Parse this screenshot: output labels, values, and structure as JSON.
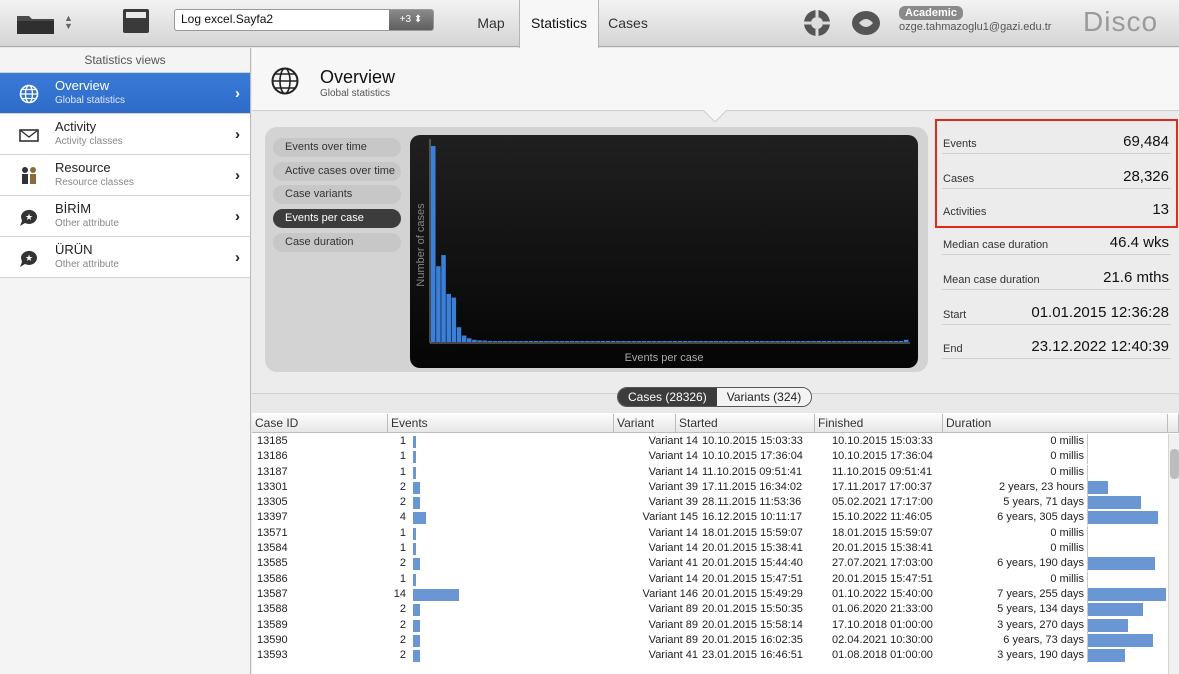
{
  "toolbar": {
    "log_name": "Log excel.Sayfa2",
    "log_badge": "+3 ⬍",
    "tabs": [
      {
        "label": "Map"
      },
      {
        "label": "Statistics"
      },
      {
        "label": "Cases"
      }
    ],
    "license_badge": "Academic",
    "user_email": "ozge.tahmazoglu1@gazi.edu.tr",
    "brand": "Disco",
    "icons": [
      "folder-icon",
      "sort-arrows-icon",
      "document-icon",
      "lifebuoy-icon",
      "bug-icon"
    ]
  },
  "sidebar": {
    "title": "Statistics views",
    "items": [
      {
        "label": "Overview",
        "sub": "Global statistics",
        "icon": "globe-icon",
        "active": true
      },
      {
        "label": "Activity",
        "sub": "Activity classes",
        "icon": "envelope-icon"
      },
      {
        "label": "Resource",
        "sub": "Resource classes",
        "icon": "people-icon"
      },
      {
        "label": "BİRİM",
        "sub": "Other attribute",
        "icon": "tag-bubble-icon"
      },
      {
        "label": "ÜRÜN",
        "sub": "Other attribute",
        "icon": "tag-bubble-icon"
      }
    ]
  },
  "header": {
    "title": "Overview",
    "subtitle": "Global statistics"
  },
  "chart_views": [
    {
      "label": "Events over time"
    },
    {
      "label": "Active cases over time"
    },
    {
      "label": "Case variants"
    },
    {
      "label": "Events per case",
      "active": true
    },
    {
      "label": "Case duration"
    }
  ],
  "chart_data": {
    "type": "bar",
    "xlabel": "Events per case",
    "ylabel": "Number of cases",
    "series": [
      {
        "values": [
          10600,
          4100,
          4700,
          2600,
          2400,
          800,
          350,
          200,
          120,
          90,
          80,
          60,
          50,
          40,
          35,
          30,
          28,
          26,
          24,
          22,
          20,
          20,
          20,
          20,
          20,
          20,
          20,
          20,
          20,
          20,
          20,
          20,
          20,
          20,
          20,
          20,
          20,
          20,
          20,
          20,
          20,
          20,
          20,
          20,
          20,
          20,
          20,
          20,
          20,
          20,
          20,
          20,
          20,
          20,
          20,
          20,
          20,
          20,
          20,
          20,
          20,
          20,
          20,
          20,
          20,
          20,
          20,
          20,
          20,
          20,
          20,
          20,
          20,
          20,
          20,
          20,
          20,
          20,
          20,
          20,
          20,
          20,
          20,
          20,
          20,
          20,
          20,
          20,
          20,
          20,
          20,
          20,
          120
        ]
      }
    ],
    "colors": {
      "bar": "#3a7fd8"
    },
    "grid": false
  },
  "stats": [
    {
      "label": "Events",
      "value": "69,484"
    },
    {
      "label": "Cases",
      "value": "28,326"
    },
    {
      "label": "Activities",
      "value": "13"
    },
    {
      "label": "Median case duration",
      "value": "46.4 wks"
    },
    {
      "label": "Mean case duration",
      "value": "21.6 mths"
    },
    {
      "label": "Start",
      "value": "01.01.2015 12:36:28"
    },
    {
      "label": "End",
      "value": "23.12.2022 12:40:39"
    }
  ],
  "table_toggle": {
    "cases": "Cases (28326)",
    "variants": "Variants (324)"
  },
  "table": {
    "columns": [
      "Case ID",
      "Events",
      "Variant",
      "Started",
      "Finished",
      "Duration"
    ],
    "rows": [
      {
        "id": "13185",
        "events": "1",
        "ev": 1,
        "variant": "Variant 14",
        "started": "10.10.2015 15:03:33",
        "finished": "10.10.2015 15:03:33",
        "duration": "0 millis",
        "dur": 0
      },
      {
        "id": "13186",
        "events": "1",
        "ev": 1,
        "variant": "Variant 14",
        "started": "10.10.2015 17:36:04",
        "finished": "10.10.2015 17:36:04",
        "duration": "0 millis",
        "dur": 0
      },
      {
        "id": "13187",
        "events": "1",
        "ev": 1,
        "variant": "Variant 14",
        "started": "11.10.2015 09:51:41",
        "finished": "11.10.2015 09:51:41",
        "duration": "0 millis",
        "dur": 0
      },
      {
        "id": "13301",
        "events": "2",
        "ev": 2,
        "variant": "Variant 39",
        "started": "17.11.2015 16:34:02",
        "finished": "17.11.2017 17:00:37",
        "duration": "2 years, 23 hours",
        "dur": 0.26
      },
      {
        "id": "13305",
        "events": "2",
        "ev": 2,
        "variant": "Variant 39",
        "started": "28.11.2015 11:53:36",
        "finished": "05.02.2021 17:17:00",
        "duration": "5 years, 71 days",
        "dur": 0.68
      },
      {
        "id": "13397",
        "events": "4",
        "ev": 4,
        "variant": "Variant 145",
        "started": "16.12.2015 10:11:17",
        "finished": "15.10.2022 11:46:05",
        "duration": "6 years, 305 days",
        "dur": 0.9
      },
      {
        "id": "13571",
        "events": "1",
        "ev": 1,
        "variant": "Variant 14",
        "started": "18.01.2015 15:59:07",
        "finished": "18.01.2015 15:59:07",
        "duration": "0 millis",
        "dur": 0
      },
      {
        "id": "13584",
        "events": "1",
        "ev": 1,
        "variant": "Variant 14",
        "started": "20.01.2015 15:38:41",
        "finished": "20.01.2015 15:38:41",
        "duration": "0 millis",
        "dur": 0
      },
      {
        "id": "13585",
        "events": "2",
        "ev": 2,
        "variant": "Variant 41",
        "started": "20.01.2015 15:44:40",
        "finished": "27.07.2021 17:03:00",
        "duration": "6 years, 190 days",
        "dur": 0.86
      },
      {
        "id": "13586",
        "events": "1",
        "ev": 1,
        "variant": "Variant 14",
        "started": "20.01.2015 15:47:51",
        "finished": "20.01.2015 15:47:51",
        "duration": "0 millis",
        "dur": 0
      },
      {
        "id": "13587",
        "events": "14",
        "ev": 14,
        "variant": "Variant 146",
        "started": "20.01.2015 15:49:29",
        "finished": "01.10.2022 15:40:00",
        "duration": "7 years, 255 days",
        "dur": 1.0
      },
      {
        "id": "13588",
        "events": "2",
        "ev": 2,
        "variant": "Variant 89",
        "started": "20.01.2015 15:50:35",
        "finished": "01.06.2020 21:33:00",
        "duration": "5 years, 134 days",
        "dur": 0.71
      },
      {
        "id": "13589",
        "events": "2",
        "ev": 2,
        "variant": "Variant 89",
        "started": "20.01.2015 15:58:14",
        "finished": "17.10.2018 01:00:00",
        "duration": "3 years, 270 days",
        "dur": 0.51
      },
      {
        "id": "13590",
        "events": "2",
        "ev": 2,
        "variant": "Variant 89",
        "started": "20.01.2015 16:02:35",
        "finished": "02.04.2021 10:30:00",
        "duration": "6 years, 73 days",
        "dur": 0.83
      },
      {
        "id": "13593",
        "events": "2",
        "ev": 2,
        "variant": "Variant 41",
        "started": "23.01.2015 16:46:51",
        "finished": "01.08.2018 01:00:00",
        "duration": "3 years, 190 days",
        "dur": 0.48
      }
    ]
  }
}
